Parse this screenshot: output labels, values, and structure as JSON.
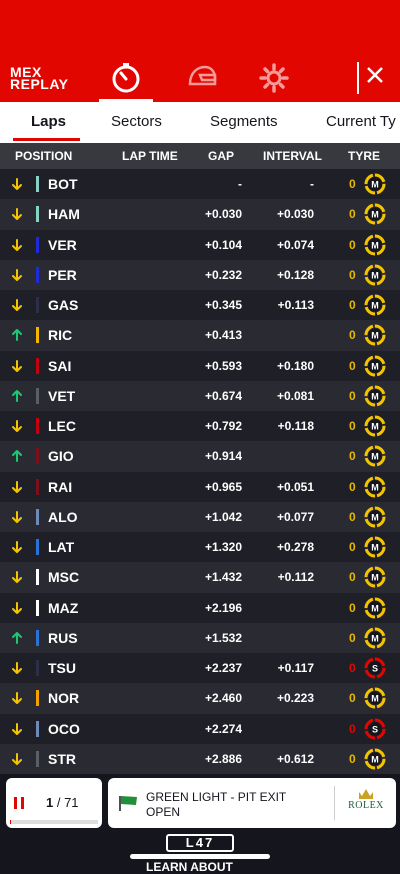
{
  "header": {
    "logo_line1": "MEX",
    "logo_line2": "REPLAY",
    "close_label": "×"
  },
  "tabs": [
    {
      "label": "Laps",
      "active": true
    },
    {
      "label": "Sectors",
      "active": false
    },
    {
      "label": "Segments",
      "active": false
    },
    {
      "label": "Current Ty",
      "active": false
    }
  ],
  "columns": {
    "position": "POSITION",
    "lap_time": "LAP TIME",
    "gap": "GAP",
    "interval": "INTERVAL",
    "tyre": "TYRE"
  },
  "colors": {
    "brand_red": "#e10600",
    "arrow_down": "#f5c400",
    "arrow_up": "#1ec873",
    "tyre_medium": "#f5c400",
    "tyre_soft": "#e10600"
  },
  "rows": [
    {
      "trend": "down",
      "team_color": "#87d1c6",
      "code": "BOT",
      "gap": "-",
      "interval": "-",
      "tyre_laps": "0",
      "tyre": "M"
    },
    {
      "trend": "down",
      "team_color": "#87d1c6",
      "code": "HAM",
      "gap": "+0.030",
      "interval": "+0.030",
      "tyre_laps": "0",
      "tyre": "M"
    },
    {
      "trend": "down",
      "team_color": "#1e2bd8",
      "code": "VER",
      "gap": "+0.104",
      "interval": "+0.074",
      "tyre_laps": "0",
      "tyre": "M"
    },
    {
      "trend": "down",
      "team_color": "#1e2bd8",
      "code": "PER",
      "gap": "+0.232",
      "interval": "+0.128",
      "tyre_laps": "0",
      "tyre": "M"
    },
    {
      "trend": "down",
      "team_color": "#2b2f4a",
      "code": "GAS",
      "gap": "+0.345",
      "interval": "+0.113",
      "tyre_laps": "0",
      "tyre": "M"
    },
    {
      "trend": "up",
      "team_color": "#f5b400",
      "code": "RIC",
      "gap": "+0.413",
      "interval": "",
      "tyre_laps": "0",
      "tyre": "M"
    },
    {
      "trend": "down",
      "team_color": "#c4000f",
      "code": "SAI",
      "gap": "+0.593",
      "interval": "+0.180",
      "tyre_laps": "0",
      "tyre": "M"
    },
    {
      "trend": "up",
      "team_color": "#5a5f66",
      "code": "VET",
      "gap": "+0.674",
      "interval": "+0.081",
      "tyre_laps": "0",
      "tyre": "M"
    },
    {
      "trend": "down",
      "team_color": "#c4000f",
      "code": "LEC",
      "gap": "+0.792",
      "interval": "+0.118",
      "tyre_laps": "0",
      "tyre": "M"
    },
    {
      "trend": "up",
      "team_color": "#7a0f1d",
      "code": "GIO",
      "gap": "+0.914",
      "interval": "",
      "tyre_laps": "0",
      "tyre": "M"
    },
    {
      "trend": "down",
      "team_color": "#7a0f1d",
      "code": "RAI",
      "gap": "+0.965",
      "interval": "+0.051",
      "tyre_laps": "0",
      "tyre": "M"
    },
    {
      "trend": "down",
      "team_color": "#6f8ab8",
      "code": "ALO",
      "gap": "+1.042",
      "interval": "+0.077",
      "tyre_laps": "0",
      "tyre": "M"
    },
    {
      "trend": "down",
      "team_color": "#2a72d6",
      "code": "LAT",
      "gap": "+1.320",
      "interval": "+0.278",
      "tyre_laps": "0",
      "tyre": "M"
    },
    {
      "trend": "down",
      "team_color": "#ffffff",
      "code": "MSC",
      "gap": "+1.432",
      "interval": "+0.112",
      "tyre_laps": "0",
      "tyre": "M"
    },
    {
      "trend": "down",
      "team_color": "#ffffff",
      "code": "MAZ",
      "gap": "+2.196",
      "interval": "",
      "tyre_laps": "0",
      "tyre": "M"
    },
    {
      "trend": "up",
      "team_color": "#2a72d6",
      "code": "RUS",
      "gap": "+1.532",
      "interval": "",
      "tyre_laps": "0",
      "tyre": "M"
    },
    {
      "trend": "down",
      "team_color": "#2b2f4a",
      "code": "TSU",
      "gap": "+2.237",
      "interval": "+0.117",
      "tyre_laps": "0",
      "tyre": "S"
    },
    {
      "trend": "down",
      "team_color": "#f5a000",
      "code": "NOR",
      "gap": "+2.460",
      "interval": "+0.223",
      "tyre_laps": "0",
      "tyre": "M"
    },
    {
      "trend": "down",
      "team_color": "#6f8ab8",
      "code": "OCO",
      "gap": "+2.274",
      "interval": "",
      "tyre_laps": "0",
      "tyre": "S"
    },
    {
      "trend": "down",
      "team_color": "#5a5f66",
      "code": "STR",
      "gap": "+2.886",
      "interval": "+0.612",
      "tyre_laps": "0",
      "tyre": "M"
    }
  ],
  "footer": {
    "current_lap": "1",
    "lap_separator": " / ",
    "total_laps": "71",
    "progress": 0.014,
    "message": "GREEN LIGHT - PIT EXIT OPEN",
    "sponsor": "ROLEX",
    "lap_badge": "L47",
    "learn_about": "LEARN ABOUT"
  }
}
